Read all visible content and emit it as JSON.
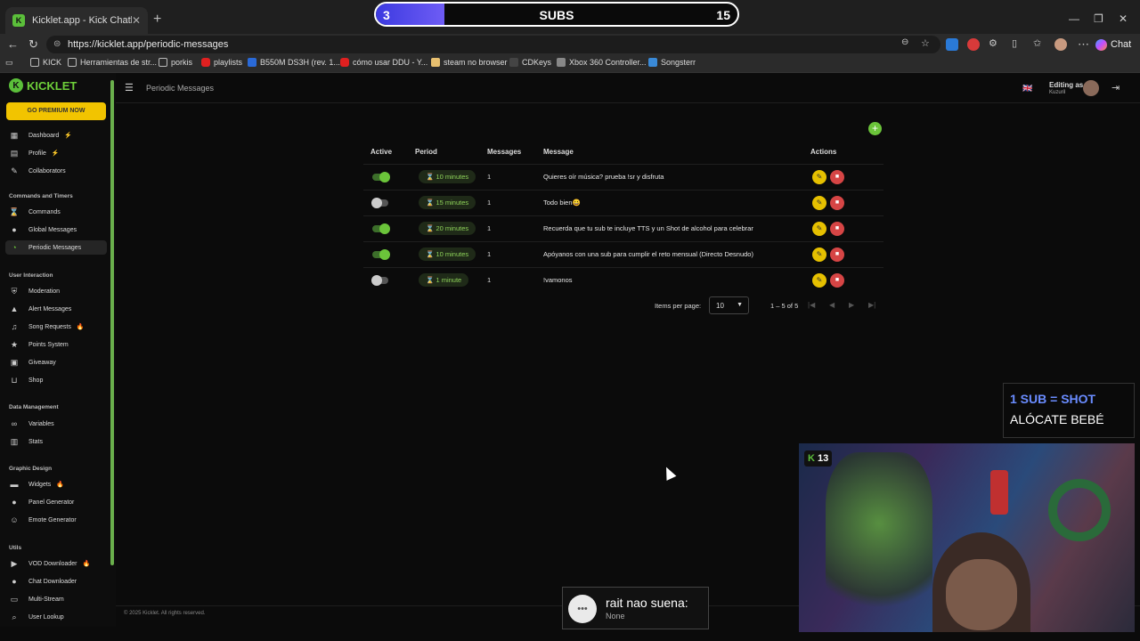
{
  "browser": {
    "tab_title": "Kicklet.app - Kick Chatbot and O",
    "url": "https://kicklet.app/periodic-messages",
    "chat_label": "Chat",
    "bookmarks": [
      "KICK",
      "Herramientas de str...",
      "porkis",
      "playlists",
      "B550M DS3H (rev. 1...",
      "cómo usar DDU - Y...",
      "steam no browser",
      "CDKeys",
      "Xbox 360 Controller...",
      "Songsterr"
    ]
  },
  "subs_overlay": {
    "current": "3",
    "label": "SUBS",
    "goal": "15",
    "progress": 0.2
  },
  "sidebar": {
    "logo": "KICKLET",
    "premium": "GO PREMIUM NOW",
    "items_top": [
      {
        "label": "Dashboard",
        "icon": "dashboard-icon",
        "badge": "⚡"
      },
      {
        "label": "Profile",
        "icon": "profile-icon",
        "badge": "⚡"
      },
      {
        "label": "Collaborators",
        "icon": "collaborators-icon",
        "badge": ""
      }
    ],
    "section_commands": "Commands and Timers",
    "items_commands": [
      {
        "label": "Commands",
        "icon": "commands-icon",
        "badge": ""
      },
      {
        "label": "Global Messages",
        "icon": "chat-icon",
        "badge": ""
      },
      {
        "label": "Periodic Messages",
        "icon": "clock-icon",
        "badge": ""
      }
    ],
    "section_interaction": "User Interaction",
    "items_interaction": [
      {
        "label": "Moderation",
        "icon": "shield-icon",
        "badge": ""
      },
      {
        "label": "Alert Messages",
        "icon": "alert-icon",
        "badge": ""
      },
      {
        "label": "Song Requests",
        "icon": "music-icon",
        "badge": "🔥"
      },
      {
        "label": "Points System",
        "icon": "star-icon",
        "badge": ""
      },
      {
        "label": "Giveaway",
        "icon": "gift-icon",
        "badge": ""
      },
      {
        "label": "Shop",
        "icon": "cart-icon",
        "badge": ""
      }
    ],
    "section_data": "Data Management",
    "items_data": [
      {
        "label": "Variables",
        "icon": "link-icon",
        "badge": ""
      },
      {
        "label": "Stats",
        "icon": "stats-icon",
        "badge": ""
      }
    ],
    "section_graphic": "Graphic Design",
    "items_graphic": [
      {
        "label": "Widgets",
        "icon": "widget-icon",
        "badge": "🔥"
      },
      {
        "label": "Panel Generator",
        "icon": "panel-icon",
        "badge": ""
      },
      {
        "label": "Emote Generator",
        "icon": "emote-icon",
        "badge": ""
      }
    ],
    "section_utils": "Utils",
    "items_utils": [
      {
        "label": "VOD Downloader",
        "icon": "video-icon",
        "badge": "🔥"
      },
      {
        "label": "Chat Downloader",
        "icon": "chat-icon",
        "badge": ""
      },
      {
        "label": "Multi-Stream",
        "icon": "monitor-icon",
        "badge": ""
      },
      {
        "label": "User Lookup",
        "icon": "search-icon",
        "badge": ""
      }
    ]
  },
  "header": {
    "title": "Periodic Messages",
    "editing_as": "Editing as",
    "user": "Kuzuril"
  },
  "table": {
    "headers": {
      "active": "Active",
      "period": "Period",
      "messages": "Messages",
      "message": "Message",
      "actions": "Actions"
    },
    "rows": [
      {
        "active": true,
        "period": "10 minutes",
        "count": "1",
        "message": "Quieres oír música? prueba !sr y disfruta"
      },
      {
        "active": false,
        "period": "15 minutes",
        "count": "1",
        "message": "Todo bien😀"
      },
      {
        "active": true,
        "period": "20 minutes",
        "count": "1",
        "message": "Recuerda que tu sub te incluye TTS y un Shot de alcohol para celebrar"
      },
      {
        "active": true,
        "period": "10 minutes",
        "count": "1",
        "message": "Apóyanos con una sub para cumplir el reto mensual (Directo Desnudo)"
      },
      {
        "active": false,
        "period": "1 minute",
        "count": "1",
        "message": "!vamonos"
      }
    ]
  },
  "pager": {
    "items_per_page_label": "Items per page:",
    "items_per_page": "10",
    "range": "1 – 5 of 5"
  },
  "footer": "© 2025 Kicklet. All rights reserved.",
  "overlay_shot": {
    "line1": "1 SUB = SHOT",
    "line2": "ALÓCATE BEBÉ"
  },
  "webcam": {
    "viewers": "13"
  },
  "toast": {
    "title": "rait nao suena:",
    "subtitle": "None"
  }
}
